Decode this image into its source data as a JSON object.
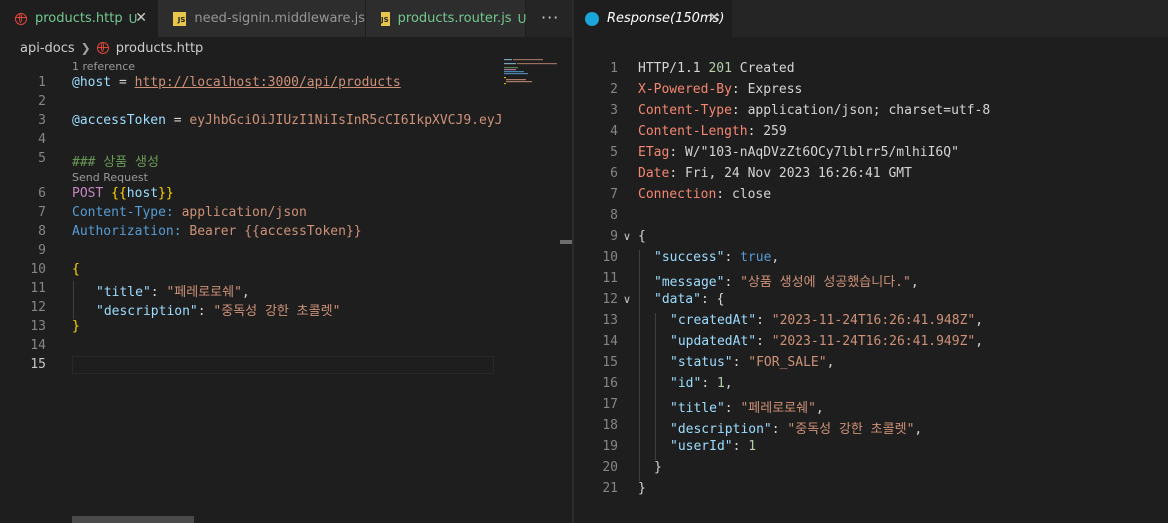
{
  "editor": {
    "tabs": [
      {
        "label": "products.http",
        "badge": "U",
        "active": true
      },
      {
        "label": "need-signin.middleware.js",
        "badge": ""
      },
      {
        "label": "products.router.js",
        "badge": "U"
      }
    ],
    "more_tabs": "···",
    "breadcrumb": {
      "folder": "api-docs",
      "file": "products.http"
    },
    "line_numbers": [
      "1",
      "2",
      "3",
      "4",
      "5",
      "6",
      "7",
      "8",
      "9",
      "10",
      "11",
      "12",
      "13",
      "14",
      "15"
    ],
    "code_lens": {
      "references": "1 reference",
      "send_request": "Send Request"
    },
    "code": {
      "host_var": "@host",
      "host_eq": " = ",
      "host_url": "http://localhost:3000/api/products",
      "token_var": "@accessToken",
      "token_eq": " = ",
      "token_val": "eyJhbGciOiJIUzI1NiIsInR5cCI6IkpXVCJ9.eyJ",
      "comment": "### 상품 생성",
      "method": "POST ",
      "url_open": "{{",
      "url_var": "host",
      "url_close": "}}",
      "h1_name": "Content-Type:",
      "h1_value": " application/json",
      "h2_name": "Authorization:",
      "h2_value": " Bearer {{accessToken}}",
      "brace_open": "{",
      "title_key": "\"title\"",
      "title_val": "\"페레로로쉐\"",
      "desc_key": "\"description\"",
      "desc_val": "\"중독성 강한 초콜렛\"",
      "brace_close": "}"
    }
  },
  "response": {
    "tab_title": "Response(150ms)",
    "line_numbers": [
      "1",
      "2",
      "3",
      "4",
      "5",
      "6",
      "7",
      "8",
      "9",
      "10",
      "11",
      "12",
      "13",
      "14",
      "15",
      "16",
      "17",
      "18",
      "19",
      "20",
      "21"
    ],
    "status": {
      "protocol": "HTTP/1.1",
      "code": "201",
      "text": "Created"
    },
    "headers": [
      {
        "name": "X-Powered-By",
        "value": "Express"
      },
      {
        "name": "Content-Type",
        "value": "application/json; charset=utf-8"
      },
      {
        "name": "Content-Length",
        "value": "259"
      },
      {
        "name": "ETag",
        "value": "W/\"103-nAqDVzZt6OCy7lblrr5/mlhiI6Q\""
      },
      {
        "name": "Date",
        "value": "Fri, 24 Nov 2023 16:26:41 GMT"
      },
      {
        "name": "Connection",
        "value": "close"
      }
    ],
    "body": {
      "success_key": "\"success\"",
      "success_val": "true",
      "message_key": "\"message\"",
      "message_val": "\"상품 생성에 성공했습니다.\"",
      "data_key": "\"data\"",
      "createdAt_key": "\"createdAt\"",
      "createdAt_val": "\"2023-11-24T16:26:41.948Z\"",
      "updatedAt_key": "\"updatedAt\"",
      "updatedAt_val": "\"2023-11-24T16:26:41.949Z\"",
      "status_key": "\"status\"",
      "status_val": "\"FOR_SALE\"",
      "id_key": "\"id\"",
      "id_val": "1",
      "title_key": "\"title\"",
      "title_val": "\"페레로로쉐\"",
      "description_key": "\"description\"",
      "description_val": "\"중독성 강한 초콜렛\"",
      "userId_key": "\"userId\"",
      "userId_val": "1"
    }
  },
  "colors": {
    "keyword": "#c586c0",
    "variable": "#9cdcfe",
    "string": "#ce9178",
    "number": "#b5cea8",
    "header_name": "#569cd6",
    "git_untracked": "#73c991",
    "brace": "#ffd700",
    "response_header": "#f48771",
    "status_code": "#b5cea8"
  }
}
